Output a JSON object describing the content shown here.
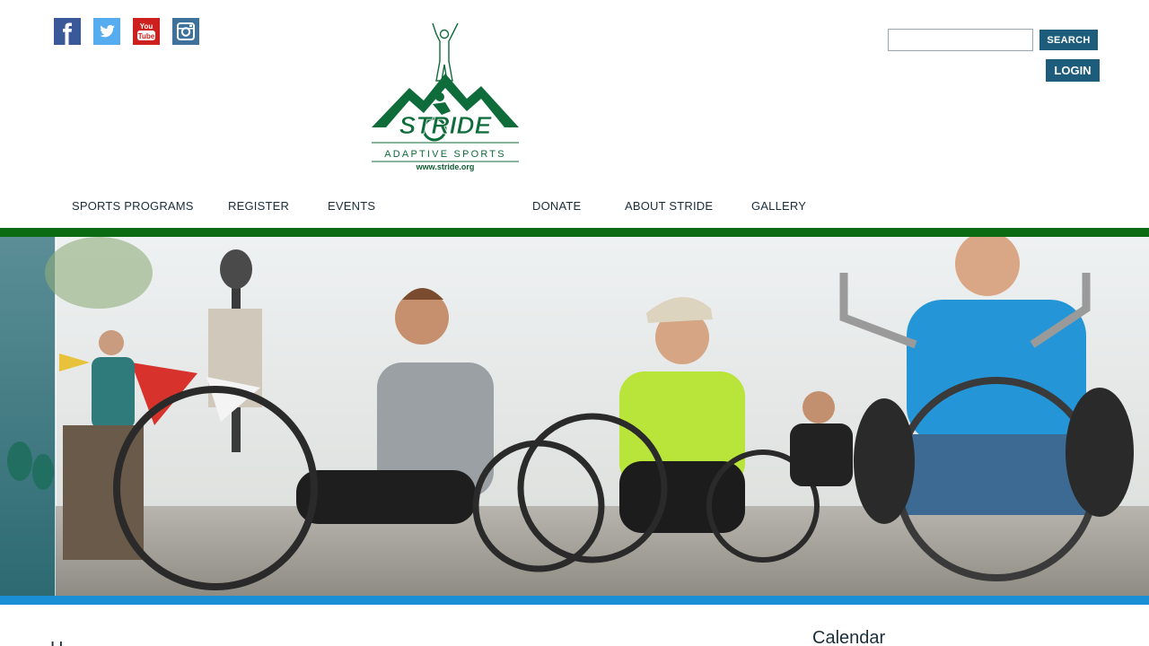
{
  "social": [
    {
      "name": "facebook-icon",
      "color": "#3b5998"
    },
    {
      "name": "twitter-icon",
      "color": "#55acee"
    },
    {
      "name": "youtube-icon",
      "color": "#cd201f"
    },
    {
      "name": "instagram-icon",
      "color": "#3f729b"
    }
  ],
  "logo": {
    "brand": "STRIDE",
    "subtitle": "ADAPTIVE SPORTS",
    "url": "www.stride.org"
  },
  "search": {
    "placeholder": "",
    "value": "",
    "button_label": "SEARCH"
  },
  "login": {
    "label": "LOGIN"
  },
  "nav": [
    {
      "label": "SPORTS PROGRAMS"
    },
    {
      "label": "REGISTER"
    },
    {
      "label": "EVENTS"
    },
    {
      "label": "DONATE"
    },
    {
      "label": "ABOUT STRIDE"
    },
    {
      "label": "GALLERY"
    }
  ],
  "colors": {
    "accent": "#1d5d7b",
    "green_bar": "#0a6b12",
    "blue_bar": "#1b8fd6",
    "logo_green": "#0e6b3a"
  },
  "content": {
    "heading_partial": "H",
    "calendar_heading": "Calendar"
  }
}
